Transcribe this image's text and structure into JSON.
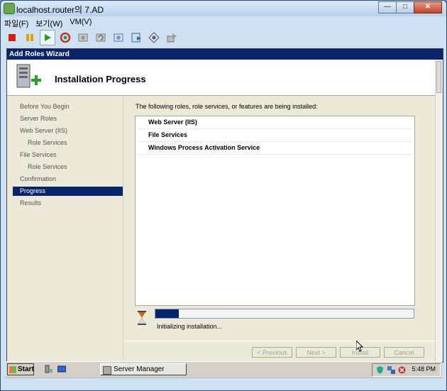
{
  "window": {
    "title": "localhost.router의 7.AD",
    "buttons": {
      "minimize": "—",
      "maximize": "□",
      "close": "✕"
    }
  },
  "menu": [
    "파일(F)",
    "보기(W)",
    "VM(V)"
  ],
  "toolbar": [
    "stop-icon",
    "pause-icon",
    "play-icon",
    "reset-icon",
    "snapshot-icon",
    "revert-icon",
    "manage-snapshots-icon",
    "ctrl-alt-del-icon",
    "settings-icon",
    "send-keys-icon"
  ],
  "wizard": {
    "title": "Add Roles Wizard",
    "heading": "Installation Progress",
    "nav": [
      {
        "label": "Before You Begin",
        "sub": false,
        "selected": false
      },
      {
        "label": "Server Roles",
        "sub": false,
        "selected": false
      },
      {
        "label": "Web Server (IIS)",
        "sub": false,
        "selected": false
      },
      {
        "label": "Role Services",
        "sub": true,
        "selected": false
      },
      {
        "label": "File Services",
        "sub": false,
        "selected": false
      },
      {
        "label": "Role Services",
        "sub": true,
        "selected": false
      },
      {
        "label": "Confirmation",
        "sub": false,
        "selected": false
      },
      {
        "label": "Progress",
        "sub": false,
        "selected": true
      },
      {
        "label": "Results",
        "sub": false,
        "selected": false
      }
    ],
    "description": "The following roles, role services, or features are being installed:",
    "items": [
      "Web Server (IIS)",
      "File Services",
      "Windows Process Activation Service"
    ],
    "progress": 0.09,
    "status": "Initializing installation...",
    "buttons": {
      "previous": "< Previous",
      "next": "Next >",
      "install": "Install",
      "cancel": "Cancel"
    }
  },
  "taskbar": {
    "start": "Start",
    "task": "Server Manager",
    "clock": "5:48 PM"
  },
  "colors": {
    "selection": "#0a246a",
    "progress": "#0a246a"
  }
}
